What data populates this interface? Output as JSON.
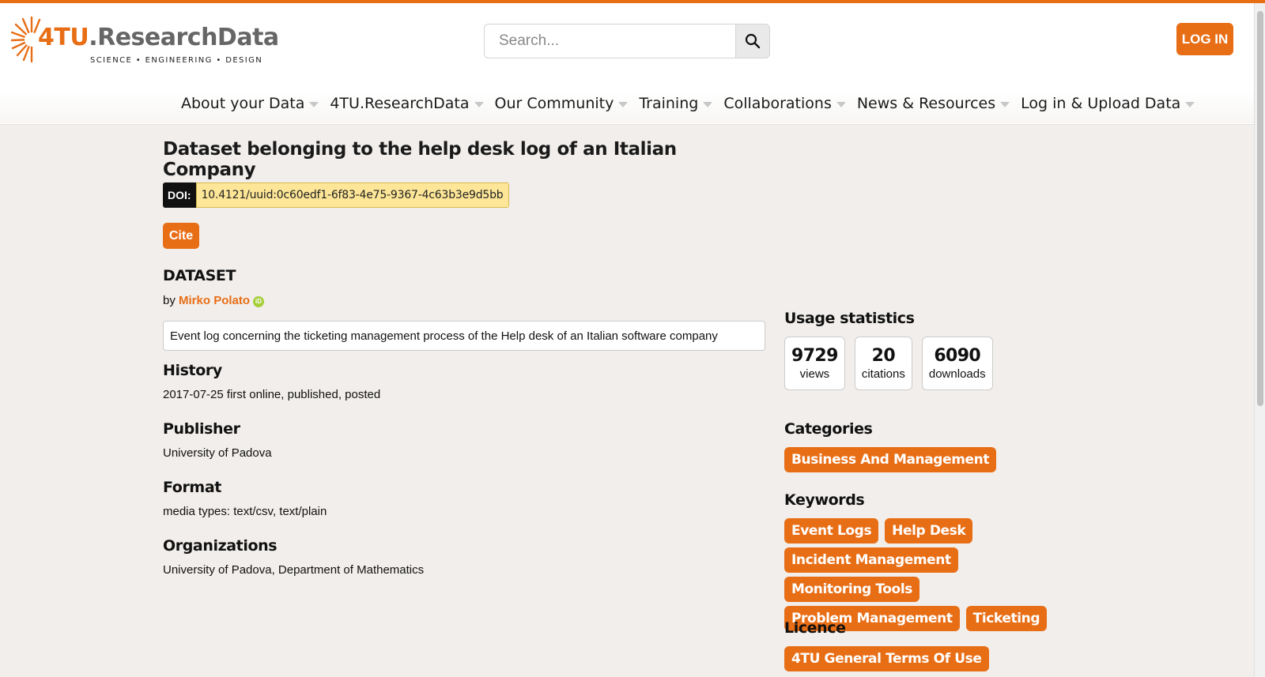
{
  "header": {
    "logo_main": "4TU",
    "logo_rest": ".ResearchData",
    "logo_tagline": "SCIENCE • ENGINEERING • DESIGN",
    "search_placeholder": "Search...",
    "login_label": "LOG IN"
  },
  "nav": {
    "items": [
      {
        "label": "About your Data"
      },
      {
        "label": "4TU.ResearchData"
      },
      {
        "label": "Our Community"
      },
      {
        "label": "Training"
      },
      {
        "label": "Collaborations"
      },
      {
        "label": "News & Resources"
      },
      {
        "label": "Log in & Upload Data"
      }
    ]
  },
  "dataset": {
    "title": "Dataset belonging to the help desk log of an Italian Company",
    "doi_label": "DOI:",
    "doi": "10.4121/uuid:0c60edf1-6f83-4e75-9367-4c63b3e9d5bb",
    "cite_label": "Cite",
    "type": "DATASET",
    "by": "by",
    "author": "Mirko Polato",
    "orcid_icon": "iD",
    "description": "Event log concerning the ticketing management process of the Help desk of an Italian software company",
    "sections": [
      {
        "heading": "History",
        "value": "2017-07-25 first online, published, posted"
      },
      {
        "heading": "Publisher",
        "value": "University of Padova"
      },
      {
        "heading": "Format",
        "value": "media types: text/csv, text/plain"
      },
      {
        "heading": "Organizations",
        "value": "University of Padova, Department of Mathematics"
      }
    ]
  },
  "sidebar": {
    "usage_heading": "Usage statistics",
    "stats": [
      {
        "value": "9729",
        "label": "views"
      },
      {
        "value": "20",
        "label": "citations"
      },
      {
        "value": "6090",
        "label": "downloads"
      }
    ],
    "categories_heading": "Categories",
    "categories": [
      "Business And Management"
    ],
    "keywords_heading": "Keywords",
    "keywords": [
      "Event Logs",
      "Help Desk",
      "Incident Management",
      "Monitoring Tools",
      "Problem Management",
      "Ticketing"
    ],
    "licence_heading": "Licence",
    "licence": "4TU General Terms Of Use"
  },
  "colors": {
    "accent": "#e86e16",
    "doi_bg": "#fde697",
    "page_bg": "#f1eeeb"
  }
}
